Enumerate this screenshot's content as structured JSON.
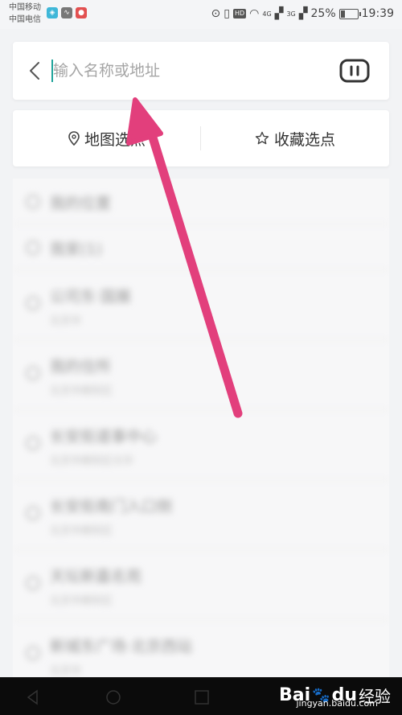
{
  "status_bar": {
    "carrier1": "中国移动",
    "carrier2": "中国电信",
    "network_4g": "4G",
    "network_3g": "3G",
    "hd": "HD",
    "battery": "25%",
    "battery_level": 0.25,
    "time": "19:39"
  },
  "search": {
    "placeholder": "输入名称或地址",
    "value": ""
  },
  "tabs": {
    "map_pick": "地图选点",
    "favorites_pick": "收藏选点"
  },
  "list_items": [
    {
      "title": "我的位置",
      "subtitle": ""
    },
    {
      "title": "我家(1)",
      "subtitle": ""
    },
    {
      "title": "公司东·国展",
      "subtitle": "北京市"
    },
    {
      "title": "我的住所",
      "subtitle": "北京市朝阳区"
    },
    {
      "title": "长安街道事中心",
      "subtitle": "北京市朝阳区光华"
    },
    {
      "title": "长安街南门入口侧",
      "subtitle": "北京市朝阳区"
    },
    {
      "title": "天坛新嘉名苑",
      "subtitle": "北京市朝阳区"
    },
    {
      "title": "新城东广场·北京西站",
      "subtitle": "北京市"
    }
  ],
  "watermark": {
    "logo": "Bai",
    "logo_suffix": "du",
    "label": "经验",
    "url": "jingyan.baidu.com"
  },
  "colors": {
    "accent": "#1fa39a",
    "arrow": "#e23f7c",
    "background": "#f2f3f5"
  }
}
